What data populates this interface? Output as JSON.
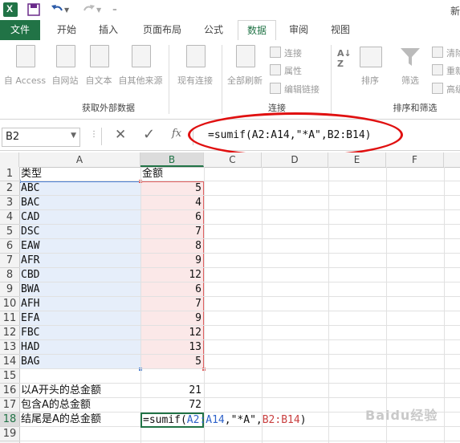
{
  "title_right": "新",
  "tabs": [
    "文件",
    "开始",
    "插入",
    "页面布局",
    "公式",
    "数据",
    "审阅",
    "视图"
  ],
  "ribbon": {
    "external_group": {
      "label": "获取外部数据",
      "buttons": [
        "自 Access",
        "自网站",
        "自文本",
        "自其他来源",
        "现有连接"
      ]
    },
    "connections_group": {
      "label": "连接",
      "refresh_label": "全部刷新",
      "items": [
        "连接",
        "属性",
        "编辑链接"
      ]
    },
    "sort_group": {
      "label": "排序和筛选",
      "sort_label": "排序",
      "filter_label": "筛选",
      "items": [
        "清除",
        "重新",
        "高级"
      ]
    }
  },
  "formula_bar": {
    "name_box": "B2",
    "fx": "fx",
    "formula": "=sumif(A2:A14,\"*A\",B2:B14)"
  },
  "columns": [
    "A",
    "B",
    "C",
    "D",
    "E",
    "F"
  ],
  "rows": [
    "1",
    "2",
    "3",
    "4",
    "5",
    "6",
    "7",
    "8",
    "9",
    "10",
    "11",
    "12",
    "13",
    "14",
    "15",
    "16",
    "17",
    "18",
    "19"
  ],
  "cells": {
    "A": [
      "类型",
      "ABC",
      "BAC",
      "CAD",
      "DSC",
      "EAW",
      "AFR",
      "CBD",
      "BWA",
      "AFH",
      "EFA",
      "FBC",
      "HAD",
      "BAG",
      "",
      "以A开头的总金额",
      "包含A的总金额",
      "结尾是A的总金额",
      ""
    ],
    "B": [
      "金额",
      "5",
      "4",
      "6",
      "7",
      "8",
      "9",
      "12",
      "6",
      "7",
      "9",
      "12",
      "13",
      "5",
      "",
      "21",
      "72",
      "",
      ""
    ]
  },
  "editing_cell": {
    "prefix": "=sumif(",
    "ref1": "A2:A14",
    "middle": ",\"*A\",",
    "ref2": "B2:B14",
    "suffix": ")"
  },
  "watermark": "Baidu经验",
  "colors": {
    "excel_green": "#217346",
    "annotation_red": "#e01010"
  }
}
